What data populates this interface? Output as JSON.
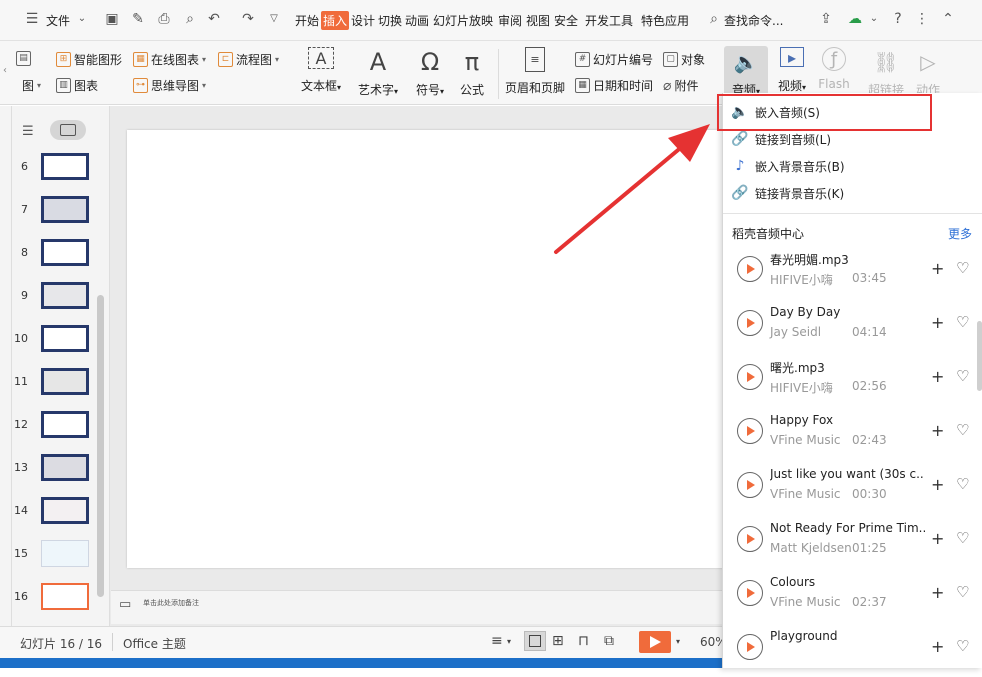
{
  "menubar": {
    "file": "文件",
    "tabs": [
      "开始",
      "插入",
      "设计",
      "切换",
      "动画",
      "幻灯片放映",
      "审阅",
      "视图",
      "安全",
      "开发工具",
      "特色应用"
    ],
    "search": "查找命令..."
  },
  "ribbon": {
    "smart_art": "智能图形",
    "online_chart": "在线图表",
    "flowchart": "流程图",
    "chart": "图表",
    "mindmap": "思维导图",
    "partial_left_top": "图",
    "partial_left_bottom": "图",
    "textbox": "文本框",
    "wordart": "艺术字",
    "symbol": "符号",
    "formula": "公式",
    "header_footer": "页眉和页脚",
    "slide_number": "幻灯片编号",
    "object": "对象",
    "date_time": "日期和时间",
    "attachment": "附件",
    "audio": "音频",
    "video": "视频",
    "flash": "Flash",
    "hyperlink": "超链接",
    "action": "动作"
  },
  "slides": [
    {
      "num": "6",
      "color": "#ffffff"
    },
    {
      "num": "7",
      "color": "#d9dbe3"
    },
    {
      "num": "8",
      "color": "#ffffff"
    },
    {
      "num": "9",
      "color": "#e7e7ea"
    },
    {
      "num": "10",
      "color": "#ffffff"
    },
    {
      "num": "11",
      "color": "#e6e6e6"
    },
    {
      "num": "12",
      "color": "#ffffff"
    },
    {
      "num": "13",
      "color": "#dcdce2"
    },
    {
      "num": "14",
      "color": "#f3f0f2"
    },
    {
      "num": "15",
      "color": "#eef6fb"
    },
    {
      "num": "16",
      "color": "#ffffff"
    }
  ],
  "notes_placeholder": "单击此处添加备注",
  "status": {
    "slide_counter": "幻灯片 16 / 16",
    "theme": "Office 主题",
    "zoom": "60%"
  },
  "dropdown": {
    "items": [
      "嵌入音频(S)",
      "链接到音频(L)",
      "嵌入背景音乐(B)",
      "链接背景音乐(K)"
    ],
    "section_title": "稻壳音频中心",
    "more": "更多",
    "music": [
      {
        "title": "春光明媚.mp3",
        "artist": "HIFIVE小嗨",
        "duration": "03:45"
      },
      {
        "title": "Day By Day",
        "artist": "Jay Seidl",
        "duration": "04:14"
      },
      {
        "title": "曙光.mp3",
        "artist": "HIFIVE小嗨",
        "duration": "02:56"
      },
      {
        "title": "Happy Fox",
        "artist": "VFine Music",
        "duration": "02:43"
      },
      {
        "title": "Just like you want (30s c...",
        "artist": "VFine Music",
        "duration": "00:30"
      },
      {
        "title": "Not Ready For Prime Tim...",
        "artist": "Matt Kjeldsen",
        "duration": "01:25"
      },
      {
        "title": "Colours",
        "artist": "VFine Music",
        "duration": "02:37"
      },
      {
        "title": "Playground",
        "artist": "",
        "duration": ""
      }
    ]
  },
  "colors": {
    "accent": "#f06b3b",
    "highlight_box": "#e53232",
    "slide_border": "#26386a"
  }
}
